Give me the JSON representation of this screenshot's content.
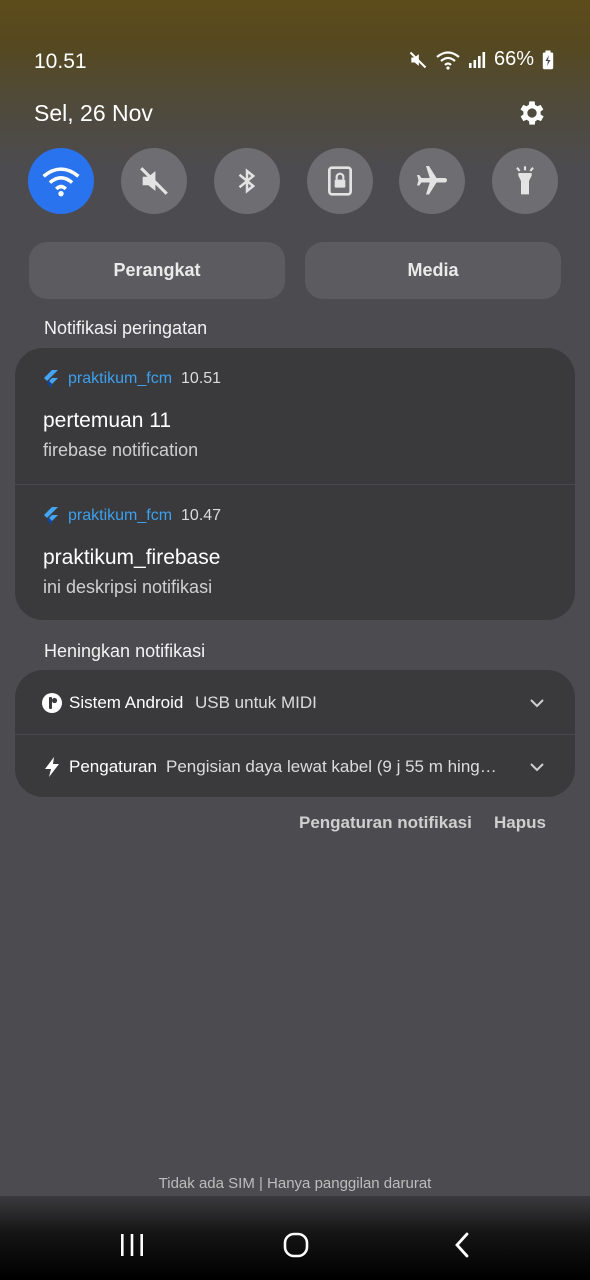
{
  "status_bar": {
    "time": "10.51",
    "battery": "66%",
    "icons": [
      "mute-icon",
      "wifi-icon",
      "signal-icon",
      "battery-icon"
    ]
  },
  "header": {
    "date": "Sel, 26 Nov",
    "settings_icon": "gear-icon"
  },
  "quick_settings": [
    {
      "name": "wifi",
      "icon": "wifi-icon",
      "active": true
    },
    {
      "name": "sound",
      "icon": "mute-icon",
      "active": false
    },
    {
      "name": "bluetooth",
      "icon": "bluetooth-icon",
      "active": false
    },
    {
      "name": "rotation-lock",
      "icon": "lock-icon",
      "active": false
    },
    {
      "name": "airplane",
      "icon": "airplane-icon",
      "active": false
    },
    {
      "name": "flashlight",
      "icon": "flashlight-icon",
      "active": false
    }
  ],
  "segments": {
    "devices": "Perangkat",
    "media": "Media"
  },
  "alert_section": {
    "label": "Notifikasi peringatan",
    "notifications": [
      {
        "app": "praktikum_fcm",
        "time": "10.51",
        "title": "pertemuan 11",
        "body": "firebase notification"
      },
      {
        "app": "praktikum_fcm",
        "time": "10.47",
        "title": "praktikum_firebase",
        "body": "ini deskripsi notifikasi"
      }
    ]
  },
  "silent_section": {
    "label": "Heningkan notifikasi",
    "notifications": [
      {
        "app": "Sistem Android",
        "text": "USB untuk MIDI"
      },
      {
        "app": "Pengaturan",
        "text": "Pengisian daya lewat kabel (9 j 55 m hing…"
      }
    ]
  },
  "actions": {
    "settings": "Pengaturan notifikasi",
    "clear": "Hapus"
  },
  "footer": {
    "sim_status": "Tidak ada SIM | Hanya panggilan darurat"
  },
  "colors": {
    "background": "#4c4b50",
    "card": "#3a3a3d",
    "accent": "#2a73ee",
    "app_name": "#3ba0ee"
  }
}
